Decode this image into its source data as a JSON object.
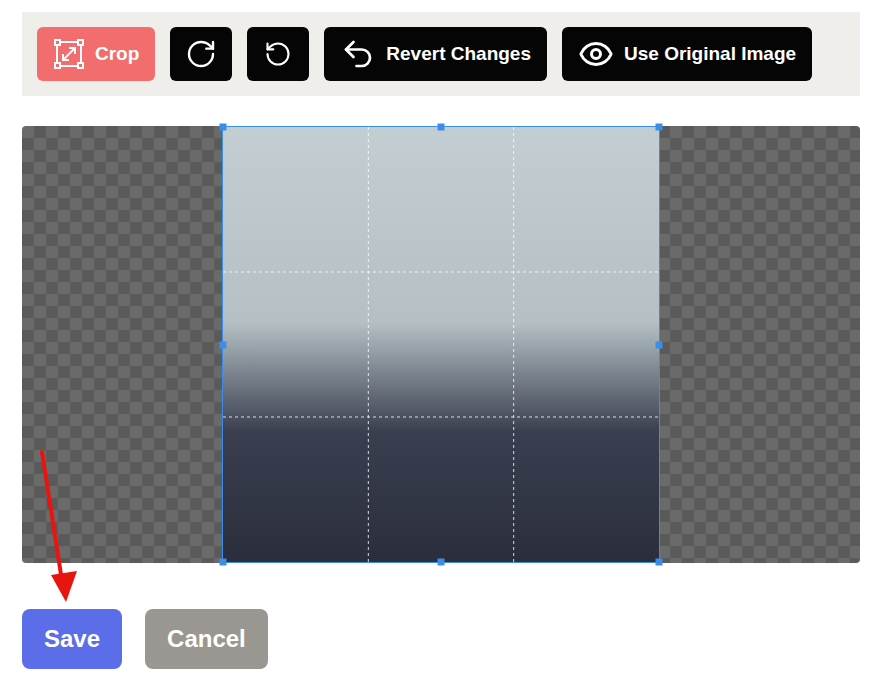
{
  "toolbar": [
    {
      "kind": "labeled",
      "label": "Crop",
      "selected": true
    },
    {
      "kind": "icon",
      "selected": false
    },
    {
      "kind": "icon",
      "selected": false
    },
    {
      "kind": "labeled",
      "label": "Revert Changes",
      "selected": false
    },
    {
      "kind": "labeled",
      "label": "Use Original Image",
      "selected": false
    }
  ],
  "canvas": {
    "photo": "plain",
    "crop_box": {
      "grid_divisions": 3
    }
  },
  "actions": [
    {
      "label": "Save",
      "kind": "primary"
    },
    {
      "label": "Cancel",
      "kind": "secondary"
    }
  ],
  "annotation": {
    "kind": "arrow",
    "target": "Save"
  }
}
